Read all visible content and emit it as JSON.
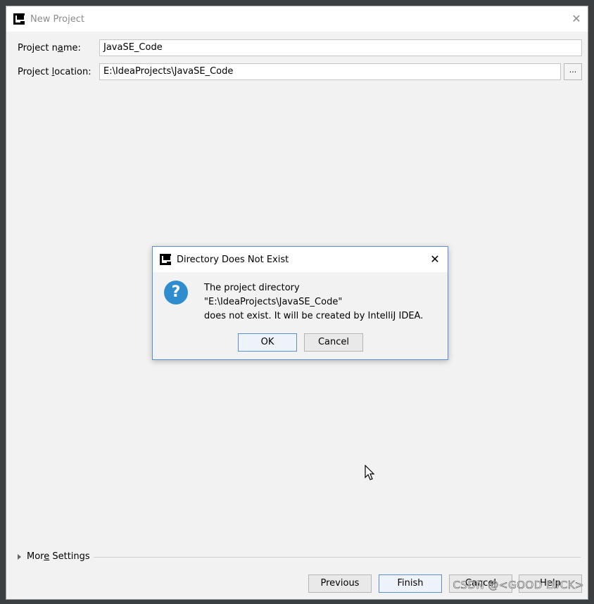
{
  "window": {
    "title": "New Project",
    "close_symbol": "✕"
  },
  "form": {
    "project_name_label_pre": "Project n",
    "project_name_label_mnemonic": "a",
    "project_name_label_post": "me:",
    "project_name_value": "JavaSE_Code",
    "project_location_label_pre": "Project ",
    "project_location_label_mnemonic": "l",
    "project_location_label_post": "ocation:",
    "project_location_value": "E:\\IdeaProjects\\JavaSE_Code",
    "browse_label": "..."
  },
  "more_settings": {
    "label_pre": "Mor",
    "label_mnemonic": "e",
    "label_post": " Settings"
  },
  "buttons": {
    "previous": "Previous",
    "finish": "Finish",
    "cancel": "Cancel",
    "help": "Help"
  },
  "dialog": {
    "title": "Directory Does Not Exist",
    "close_symbol": "✕",
    "icon_glyph": "?",
    "message_line1": "The project directory",
    "message_line2": "\"E:\\IdeaProjects\\JavaSE_Code\"",
    "message_line3": "does not exist. It will be created by IntelliJ IDEA.",
    "ok_label": "OK",
    "cancel_label": "Cancel"
  },
  "watermark": "CSDN @<GOOD LUCK>",
  "icons": {
    "app": "intellij-icon",
    "close": "close-icon",
    "question": "question-icon",
    "expand": "triangle-right-icon",
    "cursor": "mouse-pointer-icon"
  }
}
